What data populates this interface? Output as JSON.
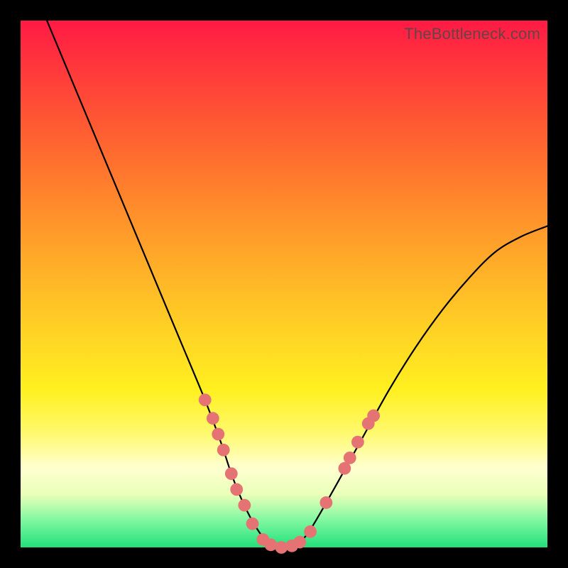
{
  "watermark": "TheBottleneck.com",
  "chart_data": {
    "type": "line",
    "title": "",
    "xlabel": "",
    "ylabel": "",
    "xlim": [
      0,
      100
    ],
    "ylim": [
      0,
      100
    ],
    "grid": false,
    "legend": false,
    "series": [
      {
        "name": "curve",
        "color": "#000000",
        "x": [
          5,
          10,
          15,
          20,
          25,
          30,
          35,
          38,
          40,
          42,
          44,
          46,
          48,
          50,
          52,
          54,
          56,
          60,
          65,
          70,
          75,
          80,
          85,
          90,
          95,
          100
        ],
        "y": [
          100,
          88,
          76,
          64,
          52,
          40,
          28,
          20,
          14,
          9,
          5,
          2,
          0.5,
          0,
          0.5,
          2,
          5,
          12,
          21,
          30,
          38,
          45,
          51,
          56,
          59,
          61
        ]
      }
    ],
    "markers": {
      "name": "scatter-points",
      "color": "#e57373",
      "radius_pct": 1.2,
      "points": [
        {
          "x": 35.0,
          "y": 28.0
        },
        {
          "x": 36.5,
          "y": 24.5
        },
        {
          "x": 37.5,
          "y": 21.5
        },
        {
          "x": 38.5,
          "y": 18.5
        },
        {
          "x": 40.0,
          "y": 14.0
        },
        {
          "x": 41.0,
          "y": 11.0
        },
        {
          "x": 42.5,
          "y": 8.0
        },
        {
          "x": 44.0,
          "y": 4.5
        },
        {
          "x": 46.0,
          "y": 1.5
        },
        {
          "x": 47.5,
          "y": 0.5
        },
        {
          "x": 49.5,
          "y": 0.0
        },
        {
          "x": 51.5,
          "y": 0.3
        },
        {
          "x": 53.0,
          "y": 1.0
        },
        {
          "x": 55.0,
          "y": 3.0
        },
        {
          "x": 58.0,
          "y": 8.5
        },
        {
          "x": 61.5,
          "y": 15.0
        },
        {
          "x": 62.5,
          "y": 17.0
        },
        {
          "x": 64.0,
          "y": 20.0
        },
        {
          "x": 66.0,
          "y": 23.5
        },
        {
          "x": 67.0,
          "y": 25.0
        }
      ]
    },
    "gradient_stops": [
      {
        "pos": 0.0,
        "color": "#ff1a44"
      },
      {
        "pos": 0.1,
        "color": "#ff3b3b"
      },
      {
        "pos": 0.25,
        "color": "#ff6a2f"
      },
      {
        "pos": 0.4,
        "color": "#ff9a2a"
      },
      {
        "pos": 0.55,
        "color": "#ffc726"
      },
      {
        "pos": 0.7,
        "color": "#fff020"
      },
      {
        "pos": 0.78,
        "color": "#fff96a"
      },
      {
        "pos": 0.85,
        "color": "#ffffd0"
      },
      {
        "pos": 0.9,
        "color": "#e9ffb8"
      },
      {
        "pos": 0.95,
        "color": "#7cf7a0"
      },
      {
        "pos": 1.0,
        "color": "#22e07a"
      }
    ]
  }
}
